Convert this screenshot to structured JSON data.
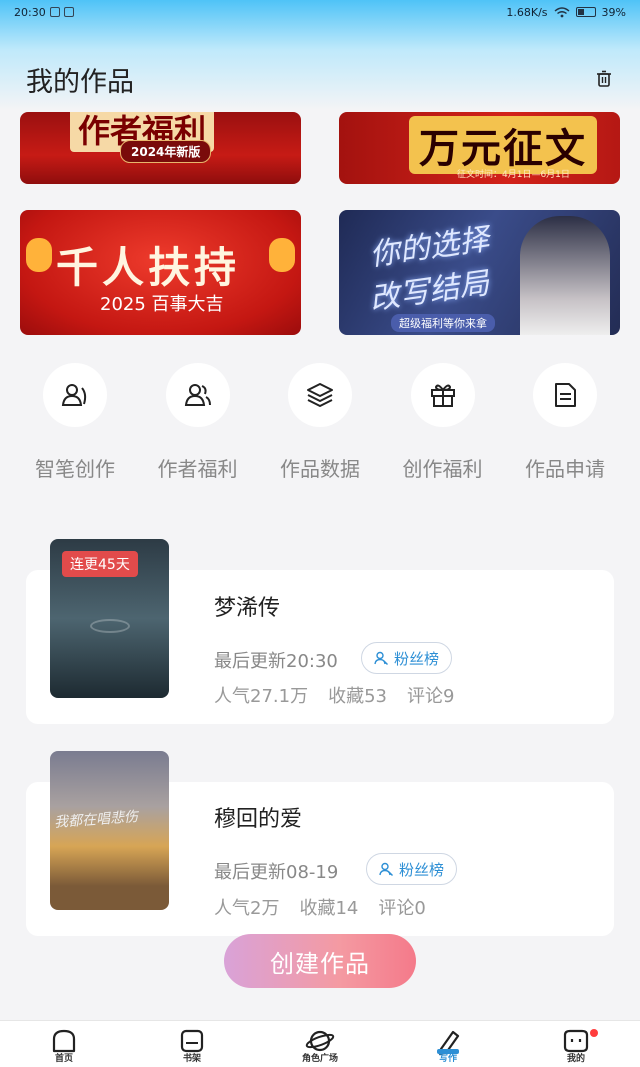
{
  "status_bar": {
    "time": "20:30",
    "speed": "1.68K/s",
    "battery": "39%"
  },
  "header": {
    "title": "我的作品"
  },
  "banners": [
    {
      "title": "作者福利",
      "subtitle": "2024年新版"
    },
    {
      "title": "万元征文",
      "subtitle": "征文时间：4月1日—6月1日"
    },
    {
      "title": "千人扶持",
      "subtitle": "2025 百事大吉"
    },
    {
      "title_line1": "你的选择",
      "title_line2": "改写结局",
      "subtitle": "超级福利等你来拿"
    }
  ],
  "quick_menu": [
    {
      "label": "智笔创作",
      "icon": "user-pen-icon"
    },
    {
      "label": "作者福利",
      "icon": "users-icon"
    },
    {
      "label": "作品数据",
      "icon": "layers-icon"
    },
    {
      "label": "创作福利",
      "icon": "gift-icon"
    },
    {
      "label": "作品申请",
      "icon": "document-icon"
    }
  ],
  "works": [
    {
      "badge": "连更45天",
      "title": "梦浠传",
      "update": "最后更新20:30",
      "fans_label": "粉丝榜",
      "popularity": "人气27.1万",
      "favorites": "收藏53",
      "comments": "评论9"
    },
    {
      "cover_text": "我都在唱悲伤",
      "title": "穆回的爱",
      "update": "最后更新08-19",
      "fans_label": "粉丝榜",
      "popularity": "人气2万",
      "favorites": "收藏14",
      "comments": "评论0"
    }
  ],
  "create_button": "创建作品",
  "bottom_nav": [
    {
      "label": "首页",
      "icon": "home-icon"
    },
    {
      "label": "书架",
      "icon": "bookshelf-icon"
    },
    {
      "label": "角色广场",
      "icon": "planet-icon"
    },
    {
      "label": "写作",
      "icon": "pen-icon",
      "active": true
    },
    {
      "label": "我的",
      "icon": "profile-icon"
    }
  ],
  "colors": {
    "accent": "#2d8fd5",
    "badge": "#e24b4b",
    "create_gradient_start": "#d9a2d8",
    "create_gradient_end": "#f47a8a"
  }
}
